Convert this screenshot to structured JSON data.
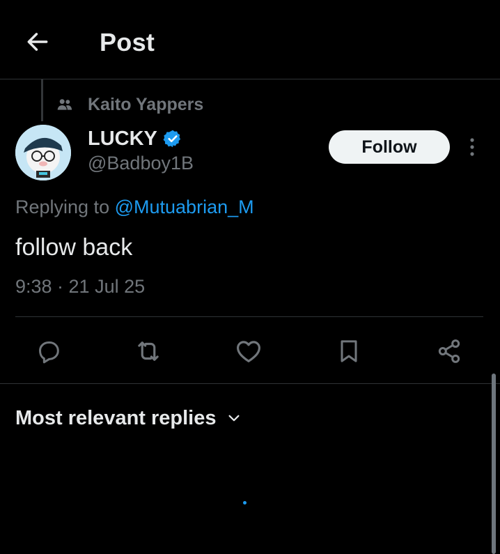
{
  "header": {
    "title": "Post",
    "back_icon": "arrow-left-icon"
  },
  "post": {
    "community": "Kaito Yappers",
    "community_icon": "people-icon",
    "author": {
      "display_name": "LUCKY",
      "verified": true,
      "verified_color": "#1d9bf0",
      "handle": "@Badboy1B"
    },
    "follow_label": "Follow",
    "more_icon": "more-vertical-icon",
    "replying_to_prefix": "Replying to",
    "replying_to_handle": "@Mutuabrian_M",
    "text": "follow back",
    "timestamp": "9:38 · 21 Jul 25"
  },
  "actions": [
    "reply-icon",
    "repost-icon",
    "like-icon",
    "bookmark-icon",
    "share-icon"
  ],
  "replies": {
    "sort_label": "Most relevant replies",
    "sort_icon": "chevron-down-icon"
  },
  "colors": {
    "background": "#000000",
    "text_primary": "#e7e9ea",
    "text_secondary": "#71767b",
    "accent": "#1d9bf0",
    "divider": "#2f3336"
  }
}
